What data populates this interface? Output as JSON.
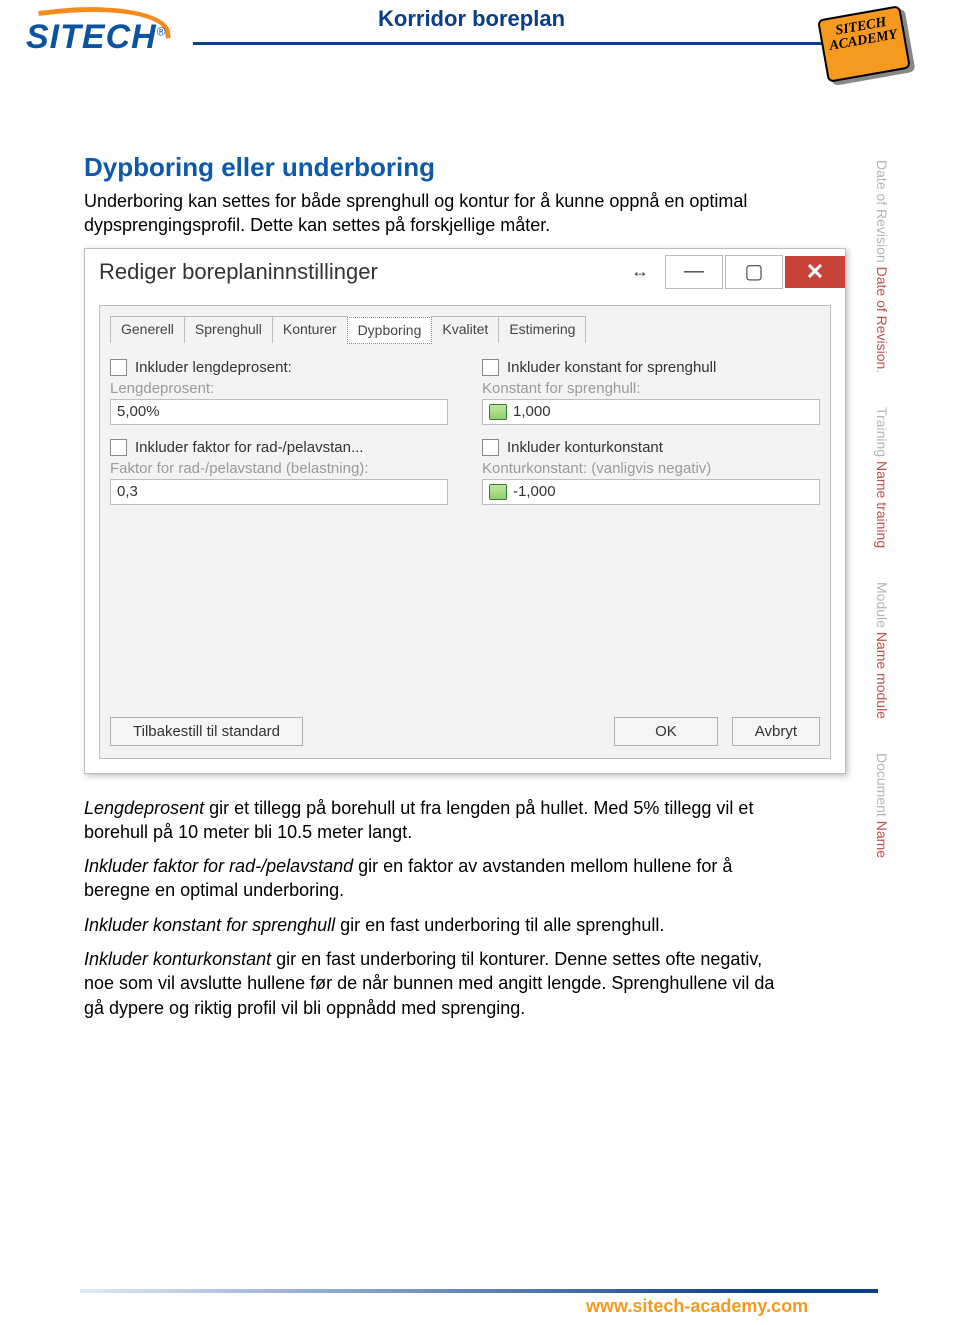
{
  "header": {
    "logo_text": "SITECH",
    "logo_trade": "®",
    "doc_title": "Korridor boreplan",
    "badge_line1": "SITECH",
    "badge_line2": "ACADEMY"
  },
  "side": {
    "s1a": "Date of Revision ",
    "s1b": "Date of Revision",
    "s1c": ".",
    "s2a": "Training ",
    "s2b": "Name training",
    "s3a": "Module ",
    "s3b": "Name module",
    "s4a": "Document ",
    "s4b": "Name"
  },
  "section": {
    "heading": "Dypboring eller underboring",
    "intro": "Underboring kan settes for både sprenghull og kontur for å kunne oppnå en optimal dypsprengingsprofil. Dette kan settes på forskjellige måter."
  },
  "dialog": {
    "title": "Rediger boreplaninnstillinger",
    "win_move": "↔",
    "win_min": "—",
    "win_max": "▢",
    "win_close": "✕",
    "tabs": [
      "Generell",
      "Sprenghull",
      "Konturer",
      "Dypboring",
      "Kvalitet",
      "Estimering"
    ],
    "active_tab": "Dypboring",
    "left": {
      "chk1": "Inkluder lengdeprosent:",
      "lbl1": "Lengdeprosent:",
      "val1": "5,00%",
      "chk2": "Inkluder faktor for rad-/pelavstan...",
      "lbl2": "Faktor for rad-/pelavstand (belastning):",
      "val2": "0,3"
    },
    "right": {
      "chk1": "Inkluder konstant for sprenghull",
      "lbl1": "Konstant for sprenghull:",
      "val1": "1,000",
      "chk2": "Inkluder konturkonstant",
      "lbl2": "Konturkonstant: (vanligvis negativ)",
      "val2": "-1,000"
    },
    "btn_reset": "Tilbakestill til standard",
    "btn_ok": "OK",
    "btn_cancel": "Avbryt"
  },
  "para": {
    "p1a": "Lengdeprosent",
    "p1b": " gir et tillegg på borehull ut fra lengden på hullet. Med 5% tillegg vil et borehull på 10 meter bli 10.5 meter langt.",
    "p2a": "Inkluder faktor for rad-/pelavstand",
    "p2b": " gir en faktor av avstanden mellom hullene for å beregne en optimal underboring.",
    "p3a": "Inkluder konstant for sprenghull",
    "p3b": " gir en fast underboring til alle sprenghull.",
    "p4a": "Inkluder konturkonstant",
    "p4b": " gir en fast underboring til konturer. Denne settes ofte negativ, noe som vil avslutte hullene før de når bunnen med angitt lengde. Sprenghullene vil da gå dypere og riktig profil vil bli oppnådd med sprenging."
  },
  "footer": {
    "url": "www.sitech-academy.com"
  }
}
